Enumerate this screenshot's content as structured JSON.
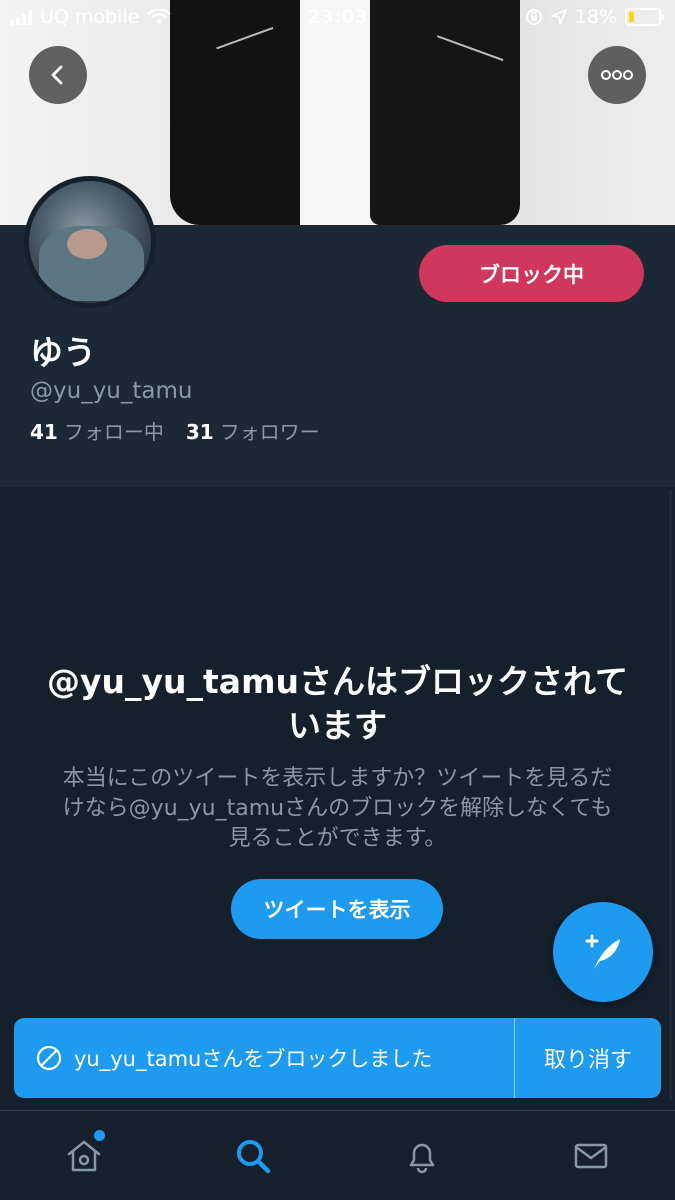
{
  "status_bar": {
    "carrier": "UQ mobile",
    "time": "23:03",
    "battery": "18%",
    "battery_level": 0.18
  },
  "profile": {
    "block_button_label": "ブロック中",
    "display_name": "ゆう",
    "handle": "@yu_yu_tamu",
    "following_count": "41",
    "following_label": "フォロー中",
    "followers_count": "31",
    "followers_label": "フォロワー"
  },
  "blocked_notice": {
    "title": "@yu_yu_tamuさんはブロックされています",
    "description": "本当にこのツイートを表示しますか？ツイートを見るだけなら@yu_yu_tamuさんのブロックを解除しなくても見ることができます。",
    "show_button_label": "ツイートを表示"
  },
  "toast": {
    "message": "yu_yu_tamuさんをブロックしました",
    "undo_label": "取り消す"
  },
  "tabs": [
    {
      "icon": "home-icon",
      "active": false,
      "notification_dot": true
    },
    {
      "icon": "search-icon",
      "active": true
    },
    {
      "icon": "bell-icon",
      "active": false
    },
    {
      "icon": "mail-icon",
      "active": false
    }
  ],
  "colors": {
    "background": "#15202b",
    "profile_background": "#1b2836",
    "accent": "#1d9bf0",
    "block_red": "#d1365b",
    "muted_text": "#8899a6"
  }
}
